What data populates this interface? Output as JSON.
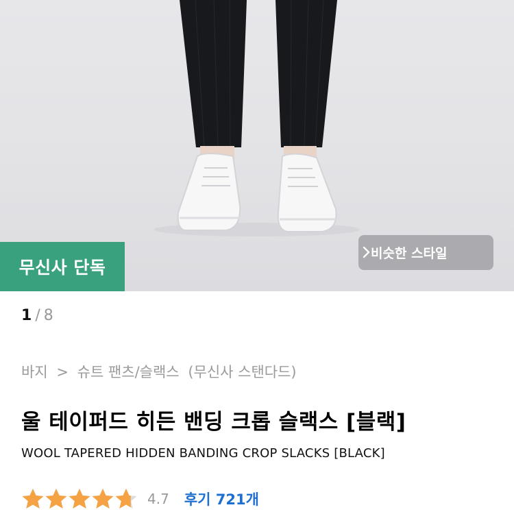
{
  "hero": {
    "image_alt_icon": "model-wearing-slacks-photo",
    "exclusive_badge": "무신사 단독",
    "similar_style_label": "비슷한 스타일",
    "similar_style_icon": "chevron-right-icon"
  },
  "gallery": {
    "current": "1",
    "separator": "/",
    "total": "8"
  },
  "breadcrumb": {
    "items": [
      "바지",
      ">",
      "슈트 팬츠/슬랙스",
      "(무신사 스탠다드)"
    ]
  },
  "product": {
    "title_kr": "울 테이퍼드 히든 밴딩 크롭 슬랙스 [블랙]",
    "title_en": "WOOL TAPERED HIDDEN BANDING CROP SLACKS [BLACK]"
  },
  "rating": {
    "stars": 4.7,
    "max_stars": 5,
    "score_text": "4.7",
    "reviews_text": "후기 721개",
    "star_color": "#f5a245",
    "review_link_color": "#1f6fd1"
  },
  "colors": {
    "badge_bg": "#3aa17f"
  }
}
